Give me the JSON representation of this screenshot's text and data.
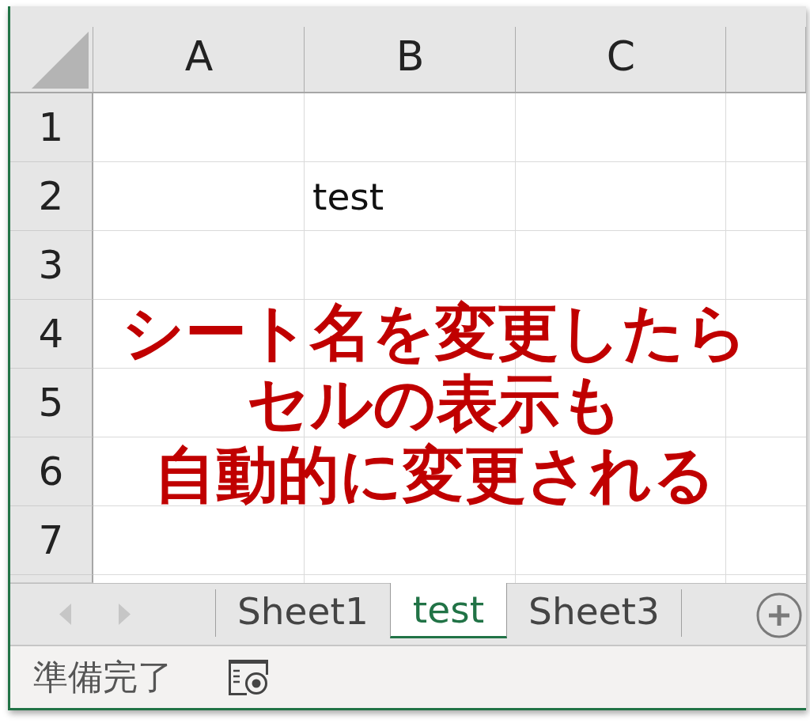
{
  "sheet": {
    "columns": [
      "A",
      "B",
      "C"
    ],
    "rows": [
      {
        "label": "1"
      },
      {
        "label": "2",
        "cells": [
          null,
          "test",
          null
        ]
      },
      {
        "label": "3"
      },
      {
        "label": "4"
      },
      {
        "label": "5"
      },
      {
        "label": "6"
      },
      {
        "label": "7"
      }
    ]
  },
  "annotation": {
    "lines": [
      "シート名を変更したら",
      "セルの表示も",
      "自動的に変更される"
    ]
  },
  "sheet_tabs": {
    "nav": [
      {
        "kind": "previous",
        "disabled": true
      },
      {
        "kind": "next",
        "disabled": true
      }
    ],
    "tabs": [
      {
        "label": "Sheet1",
        "selected": false
      },
      {
        "label": "test",
        "selected": true
      },
      {
        "label": "Sheet3",
        "selected": false
      }
    ]
  },
  "status_bar": {
    "text": "準備完了"
  }
}
